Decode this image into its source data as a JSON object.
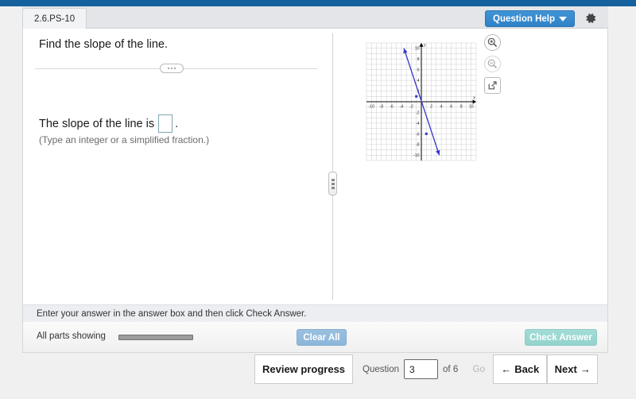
{
  "header": {
    "tab_label": "2.6.PS-10",
    "question_help_label": "Question Help",
    "settings_icon": "gear-icon"
  },
  "question": {
    "prompt": "Find the slope of the line.",
    "answer_prefix": "The slope of the line is",
    "answer_suffix": ".",
    "answer_value": "",
    "hint": "(Type an integer or a simplified fraction.)"
  },
  "graph_tools": [
    {
      "name": "zoom-in-icon",
      "label": "Zoom in"
    },
    {
      "name": "zoom-out-icon",
      "label": "Zoom out"
    },
    {
      "name": "expand-icon",
      "label": "Open in new window"
    }
  ],
  "instruction": "Enter your answer in the answer box and then click Check Answer.",
  "actions": {
    "all_parts_label": "All parts showing",
    "clear_all_label": "Clear All",
    "check_answer_label": "Check Answer"
  },
  "nav": {
    "review_label": "Review progress",
    "question_label": "Question",
    "question_number": "3",
    "of_label": "of 6",
    "go_label": "Go",
    "back_label": "Back",
    "next_label": "Next",
    "back_arrow": "←",
    "next_arrow": "→"
  },
  "chart_data": {
    "type": "line",
    "title": "",
    "xlabel": "x",
    "ylabel": "y",
    "xlim": [
      -11,
      11
    ],
    "ylim": [
      -11,
      11
    ],
    "xticks": [
      -10,
      -8,
      -6,
      -4,
      -2,
      2,
      4,
      6,
      8,
      10
    ],
    "yticks": [
      10,
      8,
      6,
      4,
      2,
      -2,
      -4,
      -6,
      -8,
      -10
    ],
    "grid": true,
    "legend": "none",
    "line_color": "#3333cc",
    "grid_color": "#c8c8c8",
    "axis_color": "#000000",
    "series": [
      {
        "name": "line",
        "slope": -3.5,
        "points": [
          {
            "x": -1,
            "y": 1,
            "marker": true
          },
          {
            "x": 1,
            "y": -6,
            "marker": true
          }
        ],
        "endpoints": [
          {
            "x": -3.5,
            "y": 10,
            "arrow": true
          },
          {
            "x": 3.6,
            "y": -10,
            "arrow": true
          }
        ]
      }
    ]
  }
}
